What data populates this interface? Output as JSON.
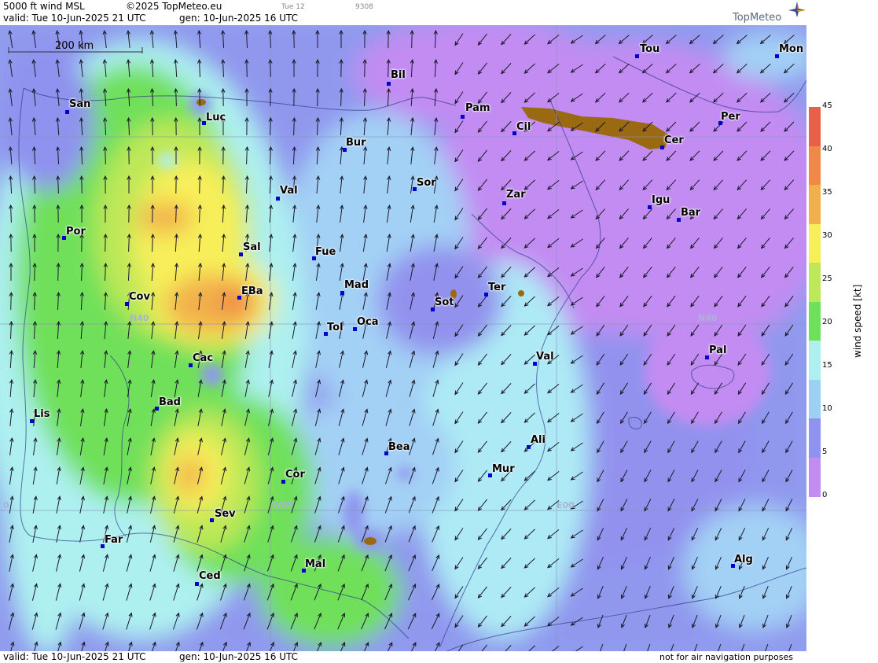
{
  "header": {
    "title": "5000 ft wind MSL",
    "copyright": "©2025 TopMeteo.eu",
    "day_tab": "Tue 12",
    "run_code": "9308",
    "valid": "valid:  Tue  10-Jun-2025  21 UTC",
    "gen": "gen: 10-Jun-2025 16 UTC",
    "brand": "TopMeteo"
  },
  "scale_bar": "200 km",
  "cities": [
    {
      "id": "san",
      "label": "San"
    },
    {
      "id": "luc",
      "label": "Luc"
    },
    {
      "id": "bil",
      "label": "Bil"
    },
    {
      "id": "pam",
      "label": "Pam"
    },
    {
      "id": "tou",
      "label": "Tou"
    },
    {
      "id": "mon",
      "label": "Mon"
    },
    {
      "id": "per",
      "label": "Per"
    },
    {
      "id": "cil",
      "label": "Cil"
    },
    {
      "id": "cer",
      "label": "Cer"
    },
    {
      "id": "bur",
      "label": "Bur"
    },
    {
      "id": "sor",
      "label": "Sor"
    },
    {
      "id": "val_n",
      "label": "Val"
    },
    {
      "id": "zar",
      "label": "Zar"
    },
    {
      "id": "igu",
      "label": "Igu"
    },
    {
      "id": "bar",
      "label": "Bar"
    },
    {
      "id": "por",
      "label": "Por"
    },
    {
      "id": "sal",
      "label": "Sal"
    },
    {
      "id": "fue",
      "label": "Fue"
    },
    {
      "id": "mad",
      "label": "Mad"
    },
    {
      "id": "cov",
      "label": "Cov"
    },
    {
      "id": "eba",
      "label": "EBa"
    },
    {
      "id": "sot",
      "label": "Sot"
    },
    {
      "id": "ter",
      "label": "Ter"
    },
    {
      "id": "tol",
      "label": "Tol"
    },
    {
      "id": "oca",
      "label": "Oca"
    },
    {
      "id": "cac",
      "label": "Cac"
    },
    {
      "id": "val_e",
      "label": "Val"
    },
    {
      "id": "pal",
      "label": "Pal"
    },
    {
      "id": "lis",
      "label": "Lis"
    },
    {
      "id": "bad",
      "label": "Bad"
    },
    {
      "id": "bea",
      "label": "Bea"
    },
    {
      "id": "ali",
      "label": "Ali"
    },
    {
      "id": "mur",
      "label": "Mur"
    },
    {
      "id": "cor",
      "label": "Cor"
    },
    {
      "id": "sev",
      "label": "Sev"
    },
    {
      "id": "far",
      "label": "Far"
    },
    {
      "id": "mal",
      "label": "Mal"
    },
    {
      "id": "ced",
      "label": "Ced"
    },
    {
      "id": "alg",
      "label": "Alg"
    }
  ],
  "grid_labels": {
    "n40_w": "N40",
    "n40_e": "N40",
    "w05": "W05",
    "e00": "E00",
    "w10": "0"
  },
  "legend": {
    "title": "wind speed  [kt]",
    "ticks": [
      "45",
      "40",
      "35",
      "30",
      "25",
      "20",
      "15",
      "10",
      "5",
      "0"
    ],
    "colors": [
      "#e8604a",
      "#f08848",
      "#f2b04c",
      "#f7ef5a",
      "#bde858",
      "#6fe05a",
      "#aef0f0",
      "#9ed0f5",
      "#8f92ee",
      "#c48cf2"
    ]
  },
  "footer": {
    "valid": "valid:  Tue  10-Jun-2025  21 UTC",
    "gen": "gen: 10-Jun-2025 16 UTC",
    "disclaimer": "not for air navigation purposes"
  }
}
